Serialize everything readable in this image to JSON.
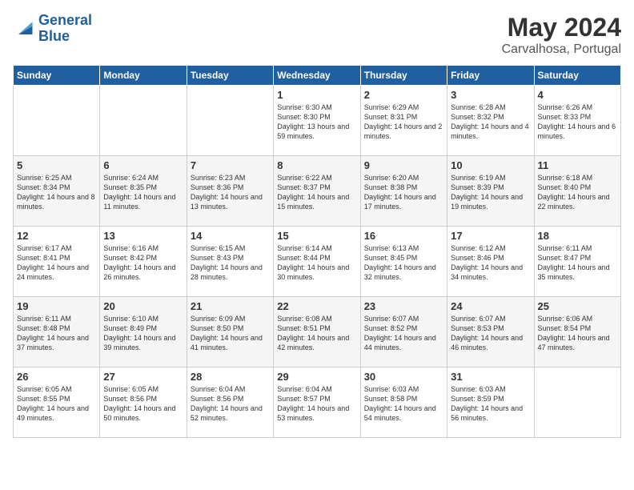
{
  "logo": {
    "line1": "General",
    "line2": "Blue"
  },
  "title": "May 2024",
  "location": "Carvalhosa, Portugal",
  "days_header": [
    "Sunday",
    "Monday",
    "Tuesday",
    "Wednesday",
    "Thursday",
    "Friday",
    "Saturday"
  ],
  "weeks": [
    [
      {
        "day": "",
        "sunrise": "",
        "sunset": "",
        "daylight": ""
      },
      {
        "day": "",
        "sunrise": "",
        "sunset": "",
        "daylight": ""
      },
      {
        "day": "",
        "sunrise": "",
        "sunset": "",
        "daylight": ""
      },
      {
        "day": "1",
        "sunrise": "Sunrise: 6:30 AM",
        "sunset": "Sunset: 8:30 PM",
        "daylight": "Daylight: 13 hours and 59 minutes."
      },
      {
        "day": "2",
        "sunrise": "Sunrise: 6:29 AM",
        "sunset": "Sunset: 8:31 PM",
        "daylight": "Daylight: 14 hours and 2 minutes."
      },
      {
        "day": "3",
        "sunrise": "Sunrise: 6:28 AM",
        "sunset": "Sunset: 8:32 PM",
        "daylight": "Daylight: 14 hours and 4 minutes."
      },
      {
        "day": "4",
        "sunrise": "Sunrise: 6:26 AM",
        "sunset": "Sunset: 8:33 PM",
        "daylight": "Daylight: 14 hours and 6 minutes."
      }
    ],
    [
      {
        "day": "5",
        "sunrise": "Sunrise: 6:25 AM",
        "sunset": "Sunset: 8:34 PM",
        "daylight": "Daylight: 14 hours and 8 minutes."
      },
      {
        "day": "6",
        "sunrise": "Sunrise: 6:24 AM",
        "sunset": "Sunset: 8:35 PM",
        "daylight": "Daylight: 14 hours and 11 minutes."
      },
      {
        "day": "7",
        "sunrise": "Sunrise: 6:23 AM",
        "sunset": "Sunset: 8:36 PM",
        "daylight": "Daylight: 14 hours and 13 minutes."
      },
      {
        "day": "8",
        "sunrise": "Sunrise: 6:22 AM",
        "sunset": "Sunset: 8:37 PM",
        "daylight": "Daylight: 14 hours and 15 minutes."
      },
      {
        "day": "9",
        "sunrise": "Sunrise: 6:20 AM",
        "sunset": "Sunset: 8:38 PM",
        "daylight": "Daylight: 14 hours and 17 minutes."
      },
      {
        "day": "10",
        "sunrise": "Sunrise: 6:19 AM",
        "sunset": "Sunset: 8:39 PM",
        "daylight": "Daylight: 14 hours and 19 minutes."
      },
      {
        "day": "11",
        "sunrise": "Sunrise: 6:18 AM",
        "sunset": "Sunset: 8:40 PM",
        "daylight": "Daylight: 14 hours and 22 minutes."
      }
    ],
    [
      {
        "day": "12",
        "sunrise": "Sunrise: 6:17 AM",
        "sunset": "Sunset: 8:41 PM",
        "daylight": "Daylight: 14 hours and 24 minutes."
      },
      {
        "day": "13",
        "sunrise": "Sunrise: 6:16 AM",
        "sunset": "Sunset: 8:42 PM",
        "daylight": "Daylight: 14 hours and 26 minutes."
      },
      {
        "day": "14",
        "sunrise": "Sunrise: 6:15 AM",
        "sunset": "Sunset: 8:43 PM",
        "daylight": "Daylight: 14 hours and 28 minutes."
      },
      {
        "day": "15",
        "sunrise": "Sunrise: 6:14 AM",
        "sunset": "Sunset: 8:44 PM",
        "daylight": "Daylight: 14 hours and 30 minutes."
      },
      {
        "day": "16",
        "sunrise": "Sunrise: 6:13 AM",
        "sunset": "Sunset: 8:45 PM",
        "daylight": "Daylight: 14 hours and 32 minutes."
      },
      {
        "day": "17",
        "sunrise": "Sunrise: 6:12 AM",
        "sunset": "Sunset: 8:46 PM",
        "daylight": "Daylight: 14 hours and 34 minutes."
      },
      {
        "day": "18",
        "sunrise": "Sunrise: 6:11 AM",
        "sunset": "Sunset: 8:47 PM",
        "daylight": "Daylight: 14 hours and 35 minutes."
      }
    ],
    [
      {
        "day": "19",
        "sunrise": "Sunrise: 6:11 AM",
        "sunset": "Sunset: 8:48 PM",
        "daylight": "Daylight: 14 hours and 37 minutes."
      },
      {
        "day": "20",
        "sunrise": "Sunrise: 6:10 AM",
        "sunset": "Sunset: 8:49 PM",
        "daylight": "Daylight: 14 hours and 39 minutes."
      },
      {
        "day": "21",
        "sunrise": "Sunrise: 6:09 AM",
        "sunset": "Sunset: 8:50 PM",
        "daylight": "Daylight: 14 hours and 41 minutes."
      },
      {
        "day": "22",
        "sunrise": "Sunrise: 6:08 AM",
        "sunset": "Sunset: 8:51 PM",
        "daylight": "Daylight: 14 hours and 42 minutes."
      },
      {
        "day": "23",
        "sunrise": "Sunrise: 6:07 AM",
        "sunset": "Sunset: 8:52 PM",
        "daylight": "Daylight: 14 hours and 44 minutes."
      },
      {
        "day": "24",
        "sunrise": "Sunrise: 6:07 AM",
        "sunset": "Sunset: 8:53 PM",
        "daylight": "Daylight: 14 hours and 46 minutes."
      },
      {
        "day": "25",
        "sunrise": "Sunrise: 6:06 AM",
        "sunset": "Sunset: 8:54 PM",
        "daylight": "Daylight: 14 hours and 47 minutes."
      }
    ],
    [
      {
        "day": "26",
        "sunrise": "Sunrise: 6:05 AM",
        "sunset": "Sunset: 8:55 PM",
        "daylight": "Daylight: 14 hours and 49 minutes."
      },
      {
        "day": "27",
        "sunrise": "Sunrise: 6:05 AM",
        "sunset": "Sunset: 8:56 PM",
        "daylight": "Daylight: 14 hours and 50 minutes."
      },
      {
        "day": "28",
        "sunrise": "Sunrise: 6:04 AM",
        "sunset": "Sunset: 8:56 PM",
        "daylight": "Daylight: 14 hours and 52 minutes."
      },
      {
        "day": "29",
        "sunrise": "Sunrise: 6:04 AM",
        "sunset": "Sunset: 8:57 PM",
        "daylight": "Daylight: 14 hours and 53 minutes."
      },
      {
        "day": "30",
        "sunrise": "Sunrise: 6:03 AM",
        "sunset": "Sunset: 8:58 PM",
        "daylight": "Daylight: 14 hours and 54 minutes."
      },
      {
        "day": "31",
        "sunrise": "Sunrise: 6:03 AM",
        "sunset": "Sunset: 8:59 PM",
        "daylight": "Daylight: 14 hours and 56 minutes."
      },
      {
        "day": "",
        "sunrise": "",
        "sunset": "",
        "daylight": ""
      }
    ]
  ]
}
